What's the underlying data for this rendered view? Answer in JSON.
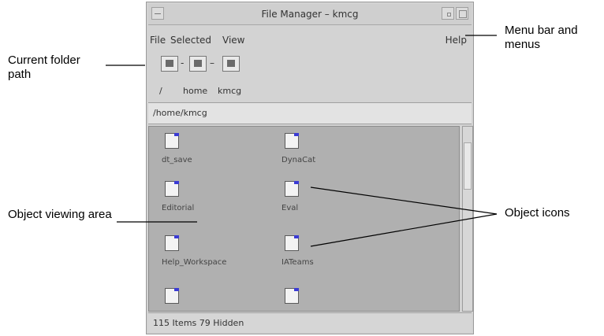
{
  "window": {
    "title": "File Manager – kmcg",
    "menus": [
      "File",
      "Selected",
      "View"
    ],
    "help_menu": "Help"
  },
  "path_bar": {
    "labels": [
      "/",
      "home",
      "kmcg"
    ],
    "current_path": "/home/kmcg"
  },
  "objects": [
    {
      "name": "dt_save"
    },
    {
      "name": "DynaCat"
    },
    {
      "name": "Editorial"
    },
    {
      "name": "Eval"
    },
    {
      "name": "Help_Workspace"
    },
    {
      "name": "IATeams"
    },
    {
      "name": ""
    },
    {
      "name": ""
    }
  ],
  "status": {
    "text": "115 Items 79 Hidden"
  },
  "callouts": {
    "menu_bar": "Menu bar and menus",
    "current_folder_path": "Current folder path",
    "object_viewing_area": "Object viewing area",
    "object_icons": "Object icons"
  },
  "colors": {
    "window_bg": "#d3d3d3",
    "view_area_bg": "#b0b0b0",
    "icon_accent": "#3b3bd4"
  }
}
